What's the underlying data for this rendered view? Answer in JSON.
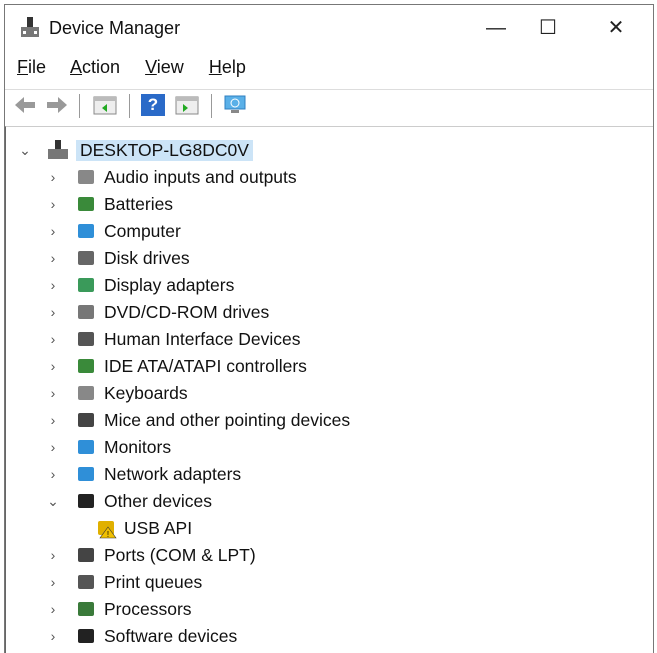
{
  "window": {
    "title": "Device Manager",
    "minimize": "—",
    "maximize": "☐",
    "close": "✕"
  },
  "menu": [
    {
      "key": "F",
      "rest": "ile"
    },
    {
      "key": "A",
      "rest": "ction"
    },
    {
      "key": "V",
      "rest": "iew"
    },
    {
      "key": "H",
      "rest": "elp"
    }
  ],
  "toolbar": {
    "back": "back-icon",
    "forward": "forward-icon",
    "help": "?"
  },
  "tree": {
    "root": "DESKTOP-LG8DC0V",
    "items": [
      {
        "label": "Audio inputs and outputs",
        "icon": "speaker-icon",
        "color": "#888"
      },
      {
        "label": "Batteries",
        "icon": "battery-icon",
        "color": "#3a8a3a"
      },
      {
        "label": "Computer",
        "icon": "computer-icon",
        "color": "#2f8fd8"
      },
      {
        "label": "Disk drives",
        "icon": "disk-icon",
        "color": "#666"
      },
      {
        "label": "Display adapters",
        "icon": "display-adapter-icon",
        "color": "#3a9a5a"
      },
      {
        "label": "DVD/CD-ROM drives",
        "icon": "dvd-icon",
        "color": "#777"
      },
      {
        "label": "Human Interface Devices",
        "icon": "hid-icon",
        "color": "#555"
      },
      {
        "label": "IDE ATA/ATAPI controllers",
        "icon": "ide-icon",
        "color": "#3a8a3a"
      },
      {
        "label": "Keyboards",
        "icon": "keyboard-icon",
        "color": "#888"
      },
      {
        "label": "Mice and other pointing devices",
        "icon": "mouse-icon",
        "color": "#444"
      },
      {
        "label": "Monitors",
        "icon": "monitor-icon",
        "color": "#2f8fd8"
      },
      {
        "label": "Network adapters",
        "icon": "network-icon",
        "color": "#2f8fd8"
      },
      {
        "label": "Other devices",
        "icon": "other-devices-icon",
        "color": "#222",
        "expanded": true
      },
      {
        "label": "USB API",
        "icon": "warning-device-icon",
        "color": "#e0b000",
        "child": true
      },
      {
        "label": "Ports (COM & LPT)",
        "icon": "port-icon",
        "color": "#444"
      },
      {
        "label": "Print queues",
        "icon": "printer-icon",
        "color": "#555"
      },
      {
        "label": "Processors",
        "icon": "processor-icon",
        "color": "#3a7a3a"
      },
      {
        "label": "Software devices",
        "icon": "software-device-icon",
        "color": "#222"
      }
    ]
  }
}
